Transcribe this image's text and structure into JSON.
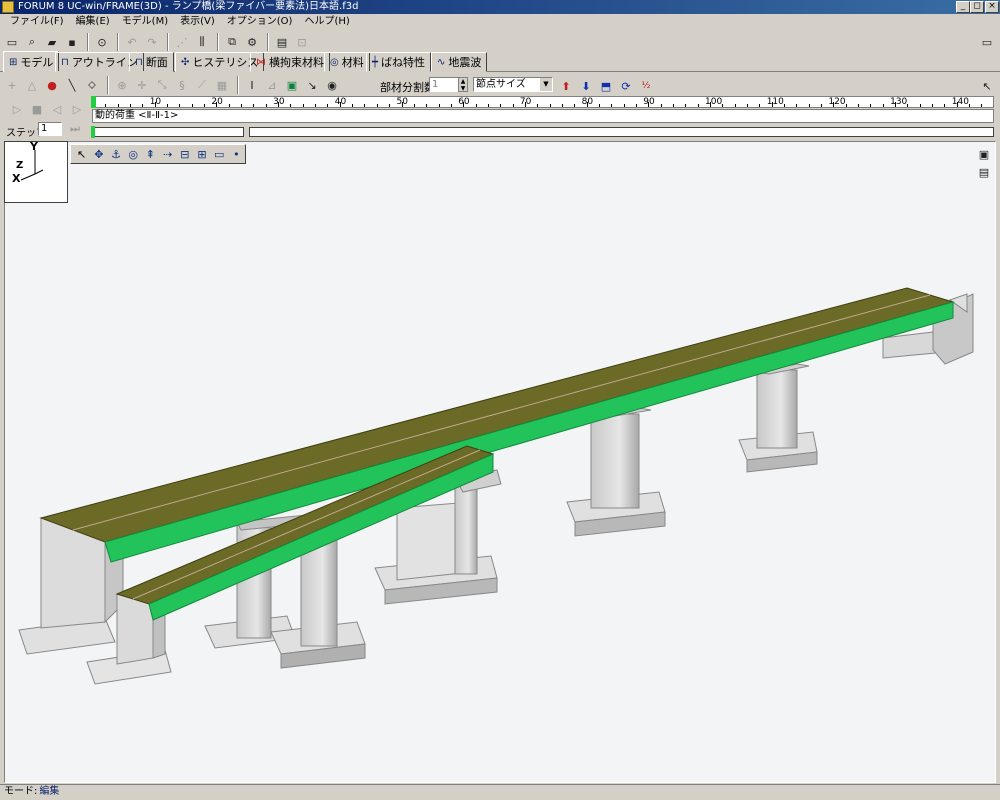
{
  "window": {
    "title": "FORUM 8  UC-win/FRAME(3D) - ランプ橋(梁ファイバー要素法)日本語.f3d",
    "btn_min": "_",
    "btn_max": "◻",
    "btn_close": "×"
  },
  "menu": [
    "ファイル(F)",
    "編集(E)",
    "モデル(M)",
    "表示(V)",
    "オプション(O)",
    "ヘルプ(H)"
  ],
  "tabs": [
    "モデル",
    "アウトライン",
    "断面",
    "ヒステリシス",
    "横拘束材料",
    "材料",
    "ばね特性",
    "地震波"
  ],
  "tab_icons": [
    "⊞",
    "⊓",
    "⊓",
    "✣",
    "⋈",
    "◎",
    "┿",
    "∿"
  ],
  "toolbar2": {
    "divisions_label": "部材分割数",
    "divisions_value": "1",
    "node_size_option": "節点サイズ"
  },
  "timeline": {
    "step_label": "ステップ",
    "step_value": "1",
    "load_case": "動的荷重 <Ⅱ-Ⅱ-1>",
    "ticks": [
      "10",
      "20",
      "30",
      "40",
      "50",
      "60",
      "70",
      "80",
      "90",
      "100",
      "110",
      "120",
      "130",
      "140"
    ]
  },
  "axes": {
    "y": "Y",
    "z": "Z",
    "x": "X"
  },
  "status": {
    "label": "モード:",
    "value": "編集"
  },
  "colors": {
    "deck_top": "#6b6a26",
    "girder": "#21c35a",
    "concrete": "#d6d6d6"
  }
}
